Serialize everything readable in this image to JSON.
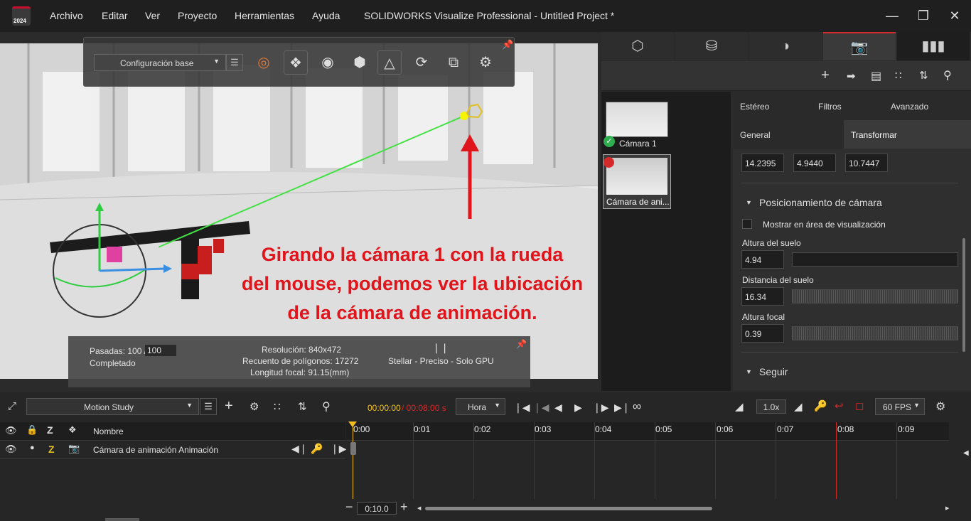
{
  "app": {
    "logo_year": "2024",
    "title": "SOLIDWORKS Visualize Professional - Untitled Project *"
  },
  "menu": [
    "Archivo",
    "Editar",
    "Ver",
    "Proyecto",
    "Herramientas",
    "Ayuda"
  ],
  "toolbar": {
    "config_select": "Configuración base"
  },
  "annotation": {
    "line1": "Girando la cámara 1 con la rueda",
    "line2": "del mouse, podemos ver la ubicación",
    "line3": "de la cámara de animación."
  },
  "stats": {
    "passes_label": "Pasadas: 100 /",
    "passes_value": "100",
    "status": "Completado",
    "resolution": "Resolución: 840x472",
    "polygons": "Recuento de polígonos: 17272",
    "focal": "Longitud focal: 91.15(mm)",
    "renderer": "Stellar - Preciso - Solo GPU"
  },
  "cameras": [
    {
      "name": "Cámara 1"
    },
    {
      "name": "Cámara de ani..."
    }
  ],
  "props": {
    "tabs_top": [
      "Estéreo",
      "Filtros",
      "Avanzado"
    ],
    "tabs_bottom": [
      "General",
      "Transformar"
    ],
    "xyz": [
      "14.2395",
      "4.9440",
      "10.7447"
    ],
    "section_pos": "Posicionamiento de cámara",
    "show_in_viewport": "Mostrar en área de visualización",
    "floor_height_label": "Altura del suelo",
    "floor_height": "4.94",
    "floor_distance_label": "Distancia del suelo",
    "floor_distance": "16.34",
    "focal_height_label": "Altura focal",
    "focal_height": "0.39",
    "section_follow": "Seguir"
  },
  "timeline": {
    "study": "Motion Study",
    "time_current": "00:00:00",
    "time_total": "/ 00:08:00 s",
    "time_unit": "Hora",
    "speed": "1.0x",
    "fps": "60 FPS",
    "column_name": "Nombre",
    "track": "Cámara de animación Animación",
    "ticks": [
      "0:00",
      "0:01",
      "0:02",
      "0:03",
      "0:04",
      "0:05",
      "0:06",
      "0:07",
      "0:08",
      "0:09"
    ],
    "duration": "0:10.0"
  },
  "colors": {
    "accent_red": "#e0151c",
    "playhead_red": "#d42a2a",
    "time_yellow": "#f0c020"
  }
}
